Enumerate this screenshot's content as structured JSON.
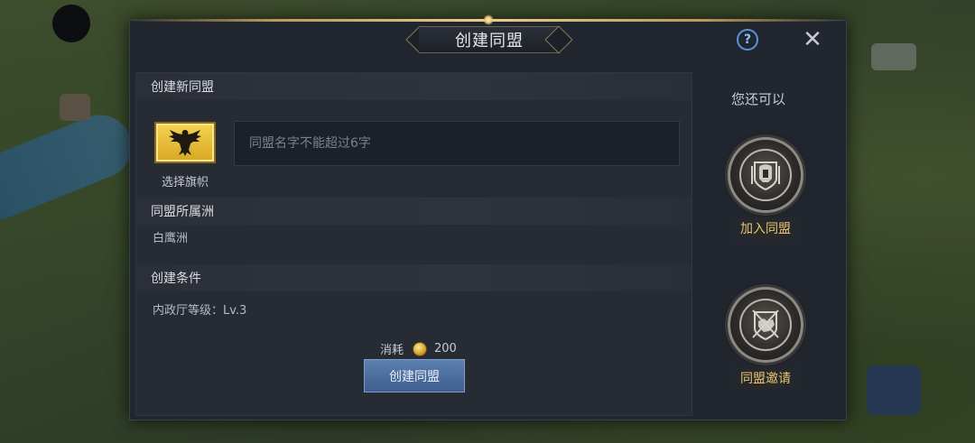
{
  "dialog": {
    "title": "创建同盟",
    "help_icon": "question-icon",
    "close_icon": "close-icon"
  },
  "create_section": {
    "header": "创建新同盟",
    "flag_label": "选择旗帜",
    "flag_icon": "eagle-emblem-icon",
    "name_input": {
      "placeholder": "同盟名字不能超过6字",
      "value": ""
    }
  },
  "continent_section": {
    "header": "同盟所属洲",
    "value": "白鹰洲"
  },
  "conditions_section": {
    "header": "创建条件",
    "value": "内政厅等级：Lv.3"
  },
  "cost": {
    "label": "消耗",
    "icon": "gold-coin-icon",
    "amount": "200"
  },
  "create_button_label": "创建同盟",
  "side": {
    "title": "您还可以",
    "actions": [
      {
        "label": "加入同盟",
        "icon": "helmet-shield-icon"
      },
      {
        "label": "同盟邀请",
        "icon": "handshake-shield-icon"
      }
    ]
  },
  "colors": {
    "panel_bg": "#22272f",
    "accent_gold": "#e8c46d",
    "button_blue": "#4a6d9e",
    "help_blue": "#5c93d4"
  }
}
